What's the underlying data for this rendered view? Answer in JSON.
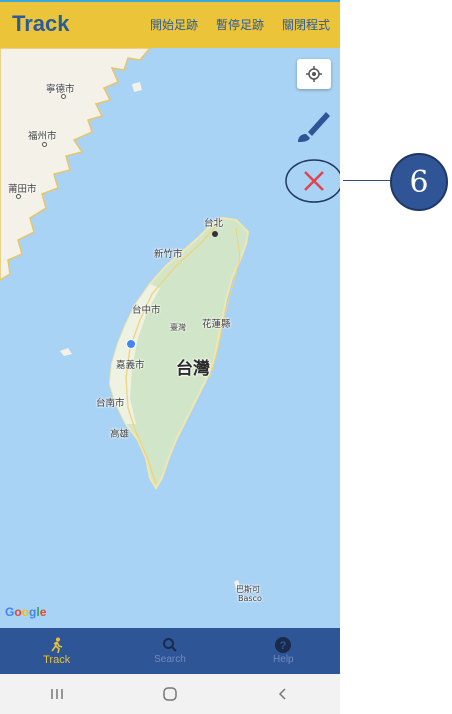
{
  "app": {
    "title": "Track",
    "actions": [
      "開始足跡",
      "暫停足跡",
      "關閉程式"
    ]
  },
  "map": {
    "attribution": "Google",
    "places": {
      "ningde": "寧德市",
      "fuzhou": "福州市",
      "putian": "莆田市",
      "taipei": "台北",
      "hsinchu": "新竹市",
      "taichung": "台中市",
      "taiwan_small": "臺灣",
      "hualien": "花蓮縣",
      "chiayi": "嘉義市",
      "taiwan": "台灣",
      "tainan": "台南市",
      "kaohsiung": "高雄",
      "babuyan": "巴斯可",
      "basco": "Basco"
    }
  },
  "controls": {
    "locate_icon": "my-location-icon",
    "brush_icon": "paint-brush-icon",
    "clear_icon": "close-x-icon"
  },
  "callout": {
    "number": "6"
  },
  "bottom_nav": [
    {
      "label": "Track",
      "icon": "walking-person-icon",
      "active": true
    },
    {
      "label": "Search",
      "icon": "search-icon",
      "active": false
    },
    {
      "label": "Help",
      "icon": "help-icon",
      "active": false
    }
  ],
  "colors": {
    "appbar": "#ebc43a",
    "title": "#2a5c9a",
    "water": "#a9d3f4",
    "bottom_nav": "#2e5596",
    "active_nav": "#e6c33a",
    "clear_x": "#e0444d",
    "callout": "#2f5597"
  }
}
